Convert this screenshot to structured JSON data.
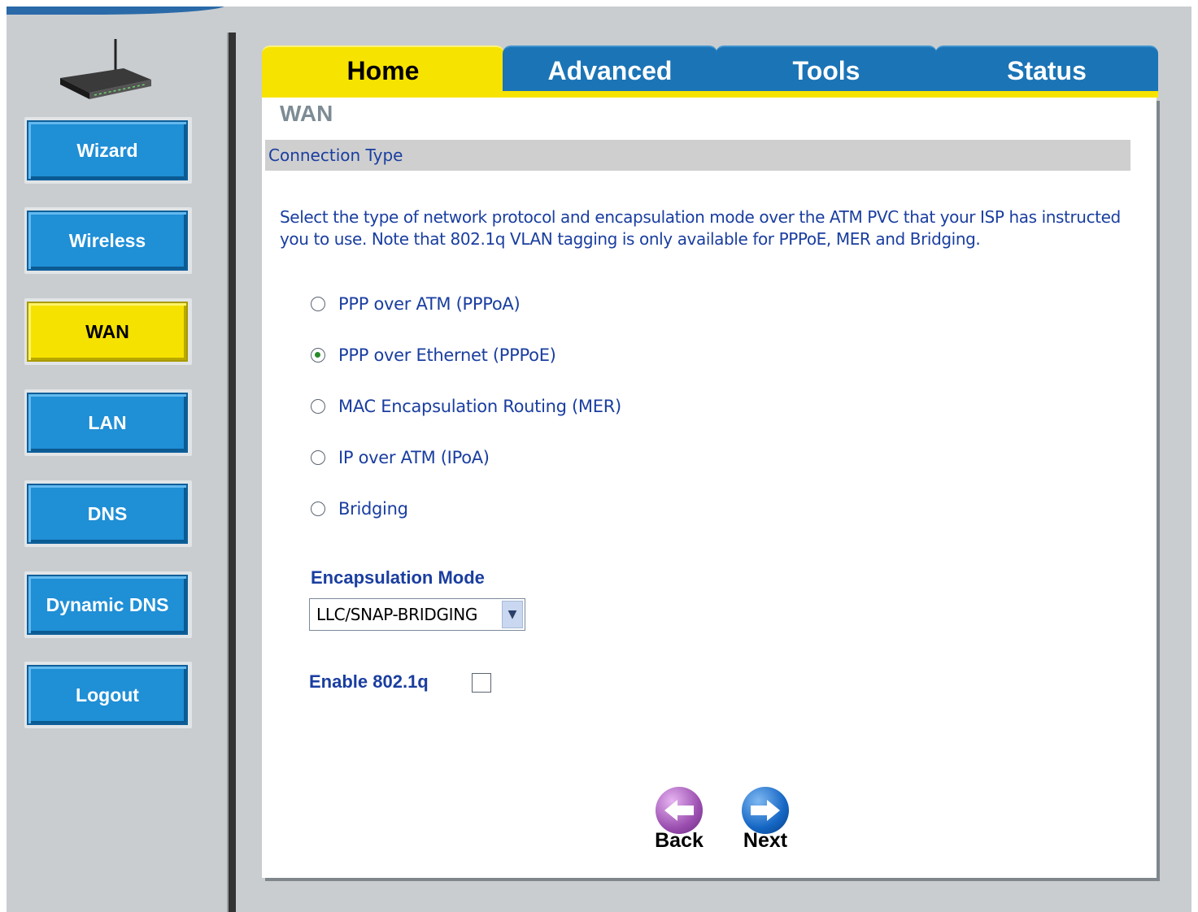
{
  "menu": [
    {
      "label": "Wizard",
      "active": false
    },
    {
      "label": "Wireless",
      "active": false
    },
    {
      "label": "WAN",
      "active": true
    },
    {
      "label": "LAN",
      "active": false
    },
    {
      "label": "DNS",
      "active": false
    },
    {
      "label": "Dynamic DNS",
      "active": false
    },
    {
      "label": "Logout",
      "active": false
    }
  ],
  "tabs": [
    {
      "label": "Home",
      "active": true
    },
    {
      "label": "Advanced",
      "active": false
    },
    {
      "label": "Tools",
      "active": false
    },
    {
      "label": "Status",
      "active": false
    }
  ],
  "page": {
    "title": "WAN",
    "section_title": "Connection Type",
    "description": "Select the type of network protocol and encapsulation mode over the ATM PVC that your ISP has instructed you to use. Note that 802.1q VLAN tagging is only available for PPPoE, MER and Bridging."
  },
  "connection_types": [
    {
      "label": "PPP over ATM (PPPoA)",
      "checked": false
    },
    {
      "label": "PPP over Ethernet (PPPoE)",
      "checked": true
    },
    {
      "label": "MAC Encapsulation Routing (MER)",
      "checked": false
    },
    {
      "label": "IP over ATM (IPoA)",
      "checked": false
    },
    {
      "label": "Bridging",
      "checked": false
    }
  ],
  "encapsulation": {
    "label": "Encapsulation Mode",
    "selected": "LLC/SNAP-BRIDGING"
  },
  "vlan": {
    "label": "Enable 802.1q",
    "checked": false
  },
  "nav": {
    "back_label": "Back",
    "next_label": "Next"
  },
  "colors": {
    "tab_blue": "#1b74b6",
    "tab_yellow": "#f7e300",
    "menu_blue": "#1f8fd6",
    "text_blue": "#1a3ea0",
    "back_purple": "#9b4fb0",
    "next_blue": "#1466c4"
  },
  "icons": {
    "logo": "router-icon",
    "back": "back-arrow-icon",
    "next": "next-arrow-icon",
    "select": "chevron-down-icon"
  }
}
